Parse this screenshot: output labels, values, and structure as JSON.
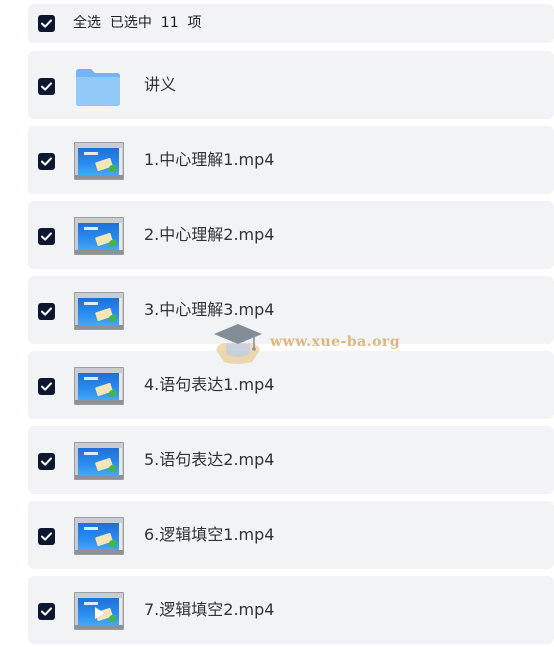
{
  "header": {
    "select_all_label": "全选",
    "selected_text": "已选中  11  项"
  },
  "files": [
    {
      "name": "讲义",
      "type": "folder",
      "checked": true
    },
    {
      "name": "1.中心理解1.mp4",
      "type": "video",
      "checked": true
    },
    {
      "name": "2.中心理解2.mp4",
      "type": "video",
      "checked": true
    },
    {
      "name": "3.中心理解3.mp4",
      "type": "video",
      "checked": true
    },
    {
      "name": "4.语句表达1.mp4",
      "type": "video",
      "checked": true
    },
    {
      "name": "5.语句表达2.mp4",
      "type": "video",
      "checked": true
    },
    {
      "name": "6.逻辑填空1.mp4",
      "type": "video",
      "checked": true
    },
    {
      "name": "7.逻辑填空2.mp4",
      "type": "video",
      "checked": true
    }
  ],
  "watermark": {
    "text": "www.xue-ba.org"
  },
  "colors": {
    "row_background": "#f2f3f5",
    "checkbox": "#0d1730",
    "watermark": "#d6a45a"
  }
}
